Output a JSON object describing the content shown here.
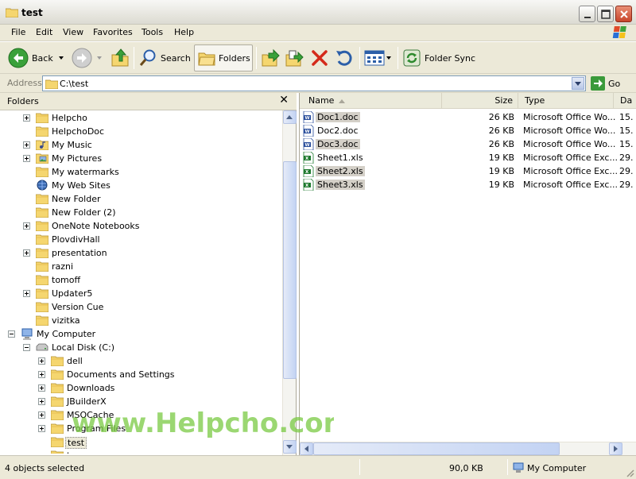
{
  "window": {
    "title": "test"
  },
  "menu": [
    "File",
    "Edit",
    "View",
    "Favorites",
    "Tools",
    "Help"
  ],
  "toolbar": {
    "back_label": "Back",
    "search_label": "Search",
    "folders_label": "Folders",
    "folder_sync_label": "Folder Sync"
  },
  "address": {
    "label": "Address",
    "path": "C:\\test",
    "go_label": "Go"
  },
  "folders_pane": {
    "title": "Folders",
    "items": [
      {
        "label": "Helpcho",
        "level": 1,
        "expander": "plus",
        "icon": "folder-icon"
      },
      {
        "label": "HelpchoDoc",
        "level": 1,
        "expander": "none",
        "icon": "folder-icon"
      },
      {
        "label": "My Music",
        "level": 1,
        "expander": "plus",
        "icon": "music-folder-icon"
      },
      {
        "label": "My Pictures",
        "level": 1,
        "expander": "plus",
        "icon": "pictures-folder-icon"
      },
      {
        "label": "My watermarks",
        "level": 1,
        "expander": "none",
        "icon": "folder-icon"
      },
      {
        "label": "My Web Sites",
        "level": 1,
        "expander": "none",
        "icon": "web-folder-icon"
      },
      {
        "label": "New Folder",
        "level": 1,
        "expander": "none",
        "icon": "folder-icon"
      },
      {
        "label": "New Folder (2)",
        "level": 1,
        "expander": "none",
        "icon": "folder-icon"
      },
      {
        "label": "OneNote Notebooks",
        "level": 1,
        "expander": "plus",
        "icon": "folder-icon"
      },
      {
        "label": "PlovdivHall",
        "level": 1,
        "expander": "none",
        "icon": "folder-icon"
      },
      {
        "label": "presentation",
        "level": 1,
        "expander": "plus",
        "icon": "folder-icon"
      },
      {
        "label": "razni",
        "level": 1,
        "expander": "none",
        "icon": "folder-icon"
      },
      {
        "label": "tomoff",
        "level": 1,
        "expander": "none",
        "icon": "folder-icon"
      },
      {
        "label": "Updater5",
        "level": 1,
        "expander": "plus",
        "icon": "folder-icon"
      },
      {
        "label": "Version Cue",
        "level": 1,
        "expander": "none",
        "icon": "folder-icon"
      },
      {
        "label": "vizitka",
        "level": 1,
        "expander": "none",
        "icon": "folder-icon"
      },
      {
        "label": "My Computer",
        "level": 0,
        "expander": "minus",
        "icon": "computer-icon"
      },
      {
        "label": "Local Disk (C:)",
        "level": 1,
        "expander": "minus",
        "icon": "drive-icon"
      },
      {
        "label": "dell",
        "level": 2,
        "expander": "plus",
        "icon": "folder-icon"
      },
      {
        "label": "Documents and Settings",
        "level": 2,
        "expander": "plus",
        "icon": "folder-icon"
      },
      {
        "label": "Downloads",
        "level": 2,
        "expander": "plus",
        "icon": "folder-icon"
      },
      {
        "label": "JBuilderX",
        "level": 2,
        "expander": "plus",
        "icon": "folder-icon"
      },
      {
        "label": "MSOCache",
        "level": 2,
        "expander": "plus",
        "icon": "folder-icon"
      },
      {
        "label": "Program Files",
        "level": 2,
        "expander": "plus",
        "icon": "folder-icon"
      },
      {
        "label": "test",
        "level": 2,
        "expander": "none",
        "icon": "folder-icon",
        "selected": true
      },
      {
        "label": "tmp",
        "level": 2,
        "expander": "none",
        "icon": "folder-icon"
      }
    ]
  },
  "file_list": {
    "columns": [
      "Name",
      "Size",
      "Type",
      "Da"
    ],
    "files": [
      {
        "name": "Doc1.doc",
        "size": "26 KB",
        "type": "Microsoft Office Wo...",
        "date": "15.",
        "icon": "word-doc-icon",
        "selected": true
      },
      {
        "name": "Doc2.doc",
        "size": "26 KB",
        "type": "Microsoft Office Wo...",
        "date": "15.",
        "icon": "word-doc-icon",
        "selected": false
      },
      {
        "name": "Doc3.doc",
        "size": "26 KB",
        "type": "Microsoft Office Wo...",
        "date": "15.",
        "icon": "word-doc-icon",
        "selected": true
      },
      {
        "name": "Sheet1.xls",
        "size": "19 KB",
        "type": "Microsoft Office Exc...",
        "date": "29.",
        "icon": "excel-sheet-icon",
        "selected": false
      },
      {
        "name": "Sheet2.xls",
        "size": "19 KB",
        "type": "Microsoft Office Exc...",
        "date": "29.",
        "icon": "excel-sheet-icon",
        "selected": true
      },
      {
        "name": "Sheet3.xls",
        "size": "19 KB",
        "type": "Microsoft Office Exc...",
        "date": "29.",
        "icon": "excel-sheet-icon",
        "selected": true
      }
    ]
  },
  "status": {
    "selection": "4 objects selected",
    "size": "90,0 KB",
    "location": "My Computer"
  },
  "watermark": "www.Helpcho.com",
  "colors": {
    "folder_yellow": "#f5d66f",
    "selection_gray": "#d4d0c8",
    "xp_face": "#ece9d8",
    "go_green": "#3a9a3a"
  }
}
